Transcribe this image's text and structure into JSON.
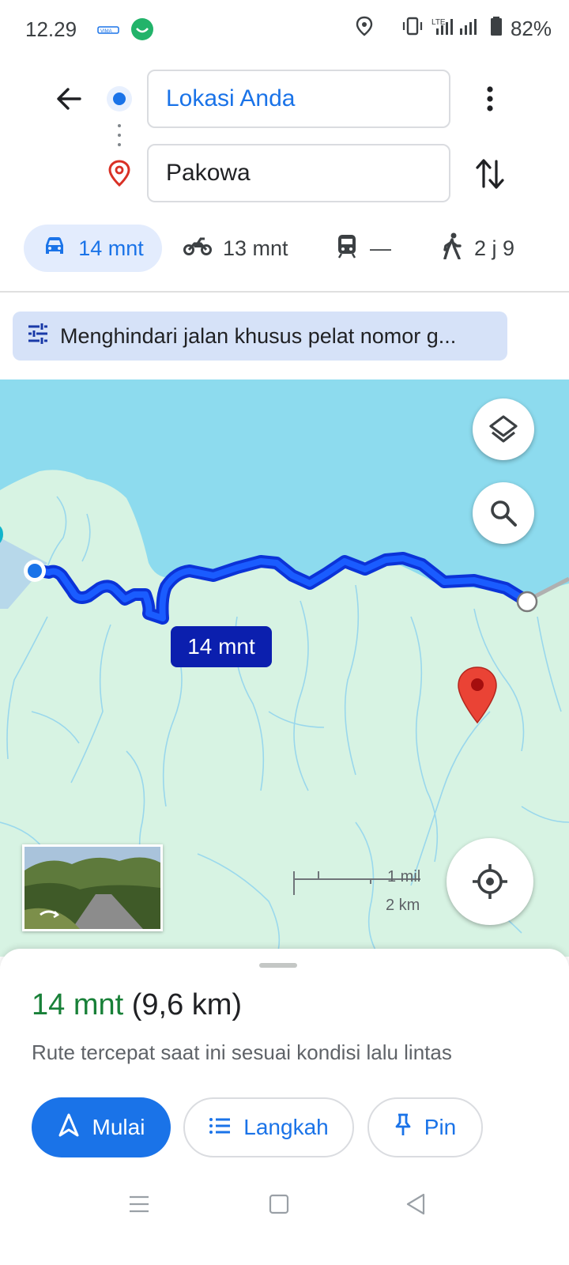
{
  "status_bar": {
    "time": "12.29",
    "battery": "82%",
    "network": "LTE"
  },
  "directions": {
    "origin": "Lokasi Anda",
    "destination": "Pakowa"
  },
  "modes": [
    {
      "label": "14 mnt",
      "icon": "car-icon",
      "selected": true
    },
    {
      "label": "13 mnt",
      "icon": "motorcycle-icon",
      "selected": false
    },
    {
      "label": "—",
      "icon": "train-icon",
      "selected": false
    },
    {
      "label": "2 j 9",
      "icon": "walk-icon",
      "selected": false
    }
  ],
  "route_option": "Menghindari jalan khusus pelat nomor g...",
  "map": {
    "route_time_label": "14 mnt",
    "scale_miles": "1 mil",
    "scale_km": "2 km",
    "colors": {
      "water": "#8ddbee",
      "land": "#d7f3e3",
      "route": "#1a3cf0",
      "pin": "#d93025"
    }
  },
  "summary": {
    "duration": "14 mnt",
    "distance": "(9,6 km)",
    "description": "Rute tercepat saat ini sesuai kondisi lalu lintas"
  },
  "actions": {
    "start": "Mulai",
    "steps": "Langkah",
    "pin": "Pin"
  },
  "accent": "#1a73e8"
}
